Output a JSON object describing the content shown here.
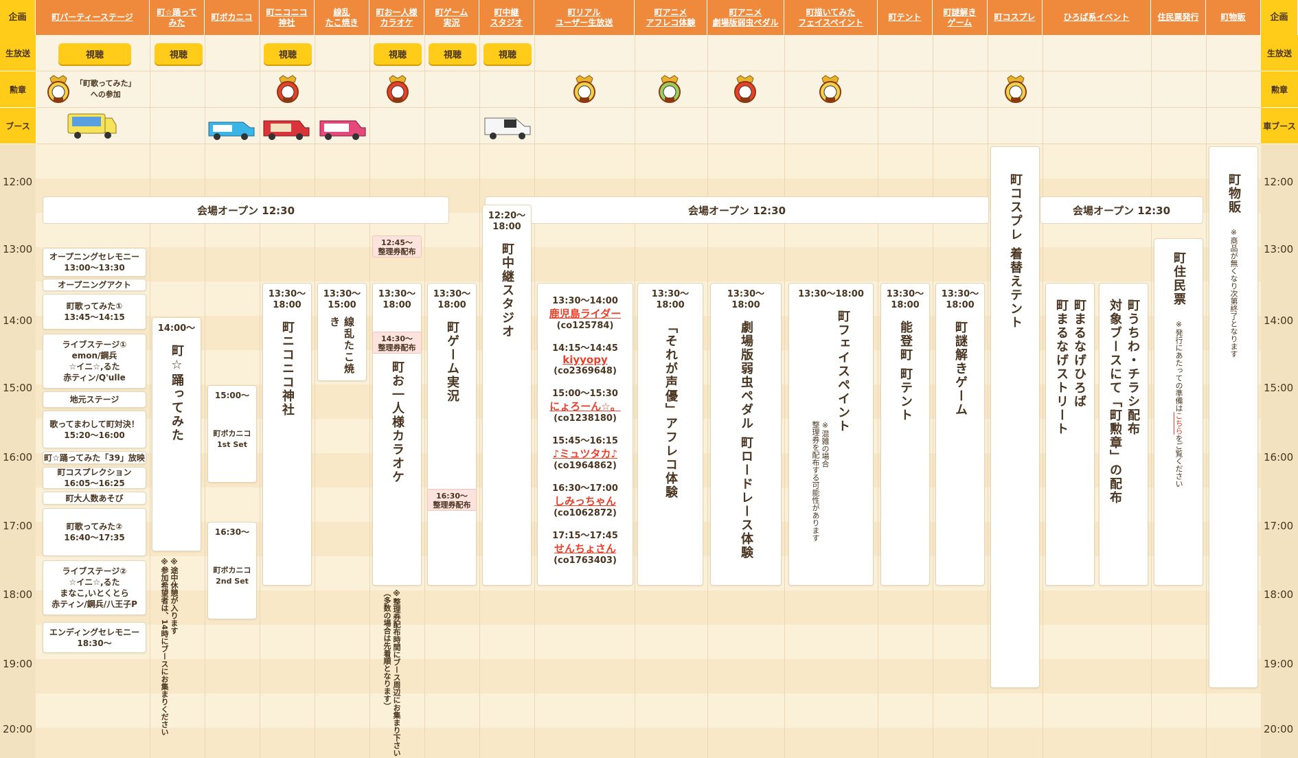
{
  "side_labels": {
    "project": "企画",
    "live": "生放送",
    "medal": "勲章",
    "booth": "ブース",
    "car_booth": "車ブース"
  },
  "headers": [
    "町パーティーステージ",
    "町☆踊って\nみた",
    "町ボカニコ",
    "町ニコニコ\n神社",
    "線乱\nたこ焼き",
    "町お一人様\nカラオケ",
    "町ゲーム\n実況",
    "町中継\nスタジオ",
    "町リアル\nユーザー生放送",
    "町アニメ\nアフレコ体験",
    "町アニメ\n劇場版弱虫ペダル",
    "町描いてみた\nフェイスペイント",
    "町テント",
    "町謎解き\nゲーム",
    "町コスプレ",
    "ひろば系イベント",
    "住民票発行",
    "町物販"
  ],
  "watch_label": "視聴",
  "medal_note": "「町歌ってみた」\nへの参加",
  "times": [
    "12:00",
    "13:00",
    "14:00",
    "15:00",
    "16:00",
    "17:00",
    "18:00",
    "19:00",
    "20:00"
  ],
  "open_label": "会場オープン 12:30",
  "party_stage": [
    "オープニングセレモニー\n13:00〜13:30",
    "オープニングアクト",
    "町歌ってみた①\n13:45〜14:15",
    "ライブステージ①\nemon/鋼兵\n☆イニ☆,るた\n赤ティン/Q'ulle",
    "地元ステージ",
    "歌ってまわして町対決！\n15:20〜16:00",
    "町☆踊ってみた「39」放映",
    "町コスプレクション\n16:05〜16:25",
    "町大人数あそび",
    "町歌ってみた②\n16:40〜17:35",
    "ライブステージ②\n☆イニ☆,るた\nまなこ,いとくとら\n赤ティン/鋼兵/八王子P",
    "エンディングセレモニー\n18:30〜"
  ],
  "odotte": {
    "time": "14:00〜",
    "title": "町☆踊ってみた",
    "note": "※途中休憩が入ります\n※参加希望者は、14時にブースにお集まりください"
  },
  "vocanico": [
    {
      "time": "15:00〜",
      "title": "町ボカニコ\n1st Set"
    },
    {
      "time": "16:30〜",
      "title": "町ボカニコ\n2nd Set"
    }
  ],
  "jinja": {
    "time": "13:30〜\n18:00",
    "title": "町ニコニコ神社"
  },
  "takoyaki": {
    "time": "13:30〜\n15:00",
    "title": "線乱たこ焼き"
  },
  "karaoke": {
    "ticket1": "12:45〜\n整理券配布",
    "time": "13:30〜\n18:00",
    "ticket2": "14:30〜\n整理券配布",
    "title": "町お一人様カラオケ",
    "note": "※整理券配布時間にブース周辺にお集まり下さい\n（多数の場合は先着順となります）"
  },
  "game": {
    "time": "13:30〜\n18:00",
    "title": "町ゲーム実況",
    "ticket": "16:30〜\n整理券配布"
  },
  "studio": {
    "time": "12:20〜\n18:00",
    "title": "町中継スタジオ"
  },
  "real_live": [
    {
      "time": "13:30〜14:00",
      "name": "鹿児島ライダー",
      "co": "(co125784)"
    },
    {
      "time": "14:15〜14:45",
      "name": "kiyyopy",
      "co": "(co2369648)"
    },
    {
      "time": "15:00〜15:30",
      "name": "にょろーん☆。",
      "co": "(co1238180)"
    },
    {
      "time": "15:45〜16:15",
      "name": "♪ミュツタカ♪",
      "co": "(co1964862)"
    },
    {
      "time": "16:30〜17:00",
      "name": "しみっちゃん",
      "co": "(co1062872)"
    },
    {
      "time": "17:15〜17:45",
      "name": "せんちょさん",
      "co": "(co1763403)"
    }
  ],
  "afreco": {
    "time": "13:30〜\n18:00",
    "title": "「それが声優」アフレコ体験"
  },
  "pedal": {
    "time": "13:30〜\n18:00",
    "title": "劇場版弱虫ペダル 町ロードレース体験"
  },
  "facepaint": {
    "time": "13:30〜18:00",
    "title": "町フェイスペイント",
    "note": "※混雑の場合\n整理券を配布する可能性があります"
  },
  "tent": {
    "time": "13:30〜\n18:00",
    "title": "能登町 町テント"
  },
  "nazo": {
    "time": "13:30〜\n18:00",
    "title": "町謎解きゲーム"
  },
  "cosplay": {
    "title": "町コスプレ 着替えテント"
  },
  "hiroba": [
    {
      "title": "町まるなげひろば\n町まるなげストリート"
    },
    {
      "title": "町うちわ・チラシ配布\n対象ブースにて「町勲章」の配布"
    }
  ],
  "juminhyo": {
    "title": "町住民票",
    "note_pre": "※発行にあたっての準備は",
    "note_link": "こちら",
    "note_post": "をご覧ください"
  },
  "bussan": {
    "title": "町物販",
    "note": "※商品が無くなり次第終了となります"
  },
  "colors": {
    "header": "#ef8a3c",
    "side": "#ffcc1a",
    "link": "#e8402b"
  }
}
